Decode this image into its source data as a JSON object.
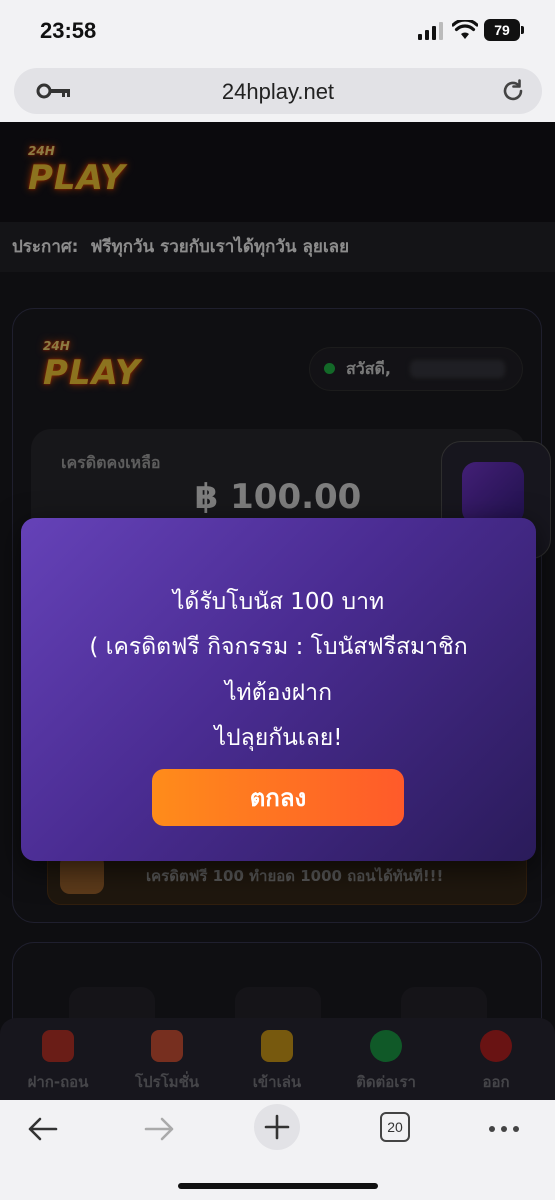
{
  "status_bar": {
    "time": "23:58",
    "battery": "79"
  },
  "browser": {
    "url": "24hplay.net",
    "tabs_count": "20"
  },
  "site": {
    "logo_small": "24H",
    "logo_big": "PLAY",
    "announcement_label": "ประกาศ:",
    "announcement_text": "ฟรีทุกวัน รวยกับเราได้ทุกวัน ลุยเลย"
  },
  "account": {
    "greeting": "สวัสดี,",
    "credit_label": "เครดิตคงเหลือ",
    "credit_value": "฿ 100.00",
    "promo_text": "เครดิตฟรี 100 ทำยอด 1000 ถอนได้ทันที!!!"
  },
  "modal": {
    "line1": "ได้รับโบนัส 100 บาท",
    "line2": "( เครดิตฟรี กิจกรรม : โบนัสฟรีสมาชิก",
    "line3": "ไท่ต้องฝาก",
    "line4": "ไปลุยกันเลย!",
    "ok_label": "ตกลง"
  },
  "bottom_nav": {
    "items": [
      {
        "label": "ฝาก-ถอน",
        "icon": "wallet-icon"
      },
      {
        "label": "โปรโมชั่น",
        "icon": "gift-icon"
      },
      {
        "label": "เข้าเล่น",
        "icon": "play-logo-icon"
      },
      {
        "label": "ติดต่อเรา",
        "icon": "chat-icon"
      },
      {
        "label": "ออก",
        "icon": "power-icon"
      }
    ]
  },
  "colors": {
    "accent_orange": "#ff7a1f",
    "modal_purple": "#5a38a8",
    "online_green": "#23c04a"
  }
}
